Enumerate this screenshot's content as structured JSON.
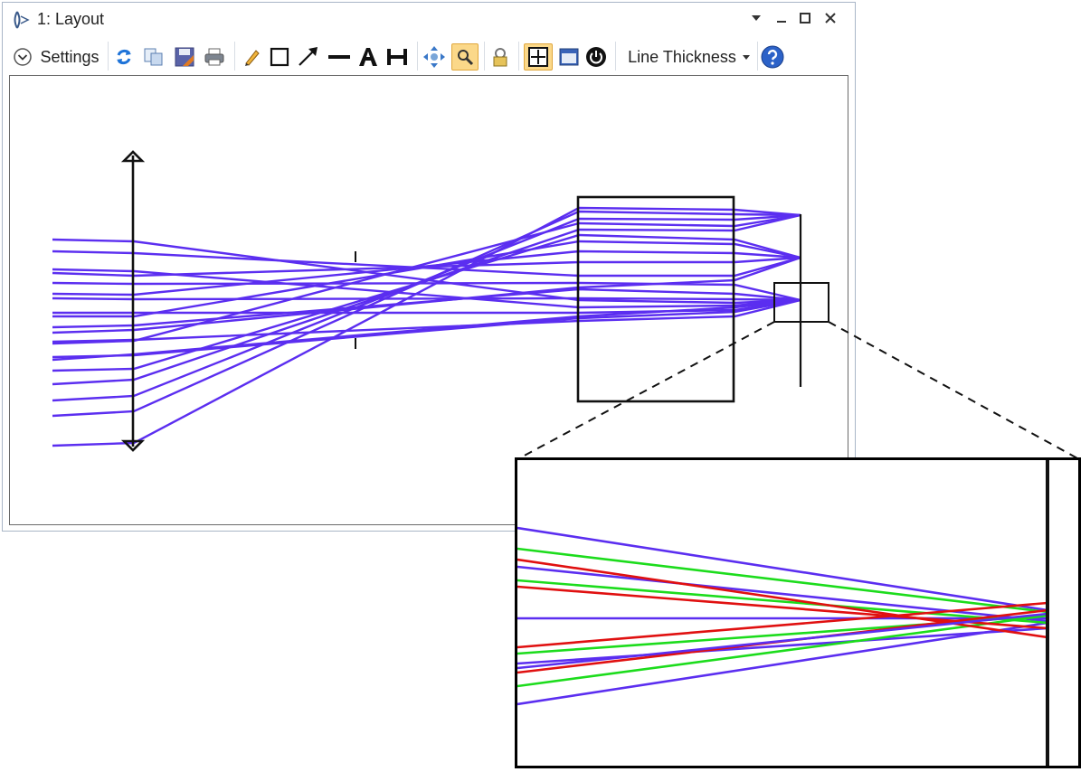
{
  "window": {
    "title": "1: Layout"
  },
  "toolbar": {
    "settings_label": "Settings",
    "line_thickness_label": "Line Thickness"
  },
  "icons": [
    "dropdown-arrow-icon",
    "minimize-icon",
    "maximize-icon",
    "close-icon",
    "settings-chevron-icon",
    "refresh-icon",
    "copy-icon",
    "save-icon",
    "print-icon",
    "pencil-icon",
    "rectangle-icon",
    "arrow-icon",
    "line-icon",
    "text-icon",
    "dimension-icon",
    "pan-icon",
    "zoom-icon",
    "lock-icon",
    "fit-view-icon",
    "window-icon",
    "power-icon",
    "help-icon"
  ],
  "colors": {
    "ray_blue": "#5b2ef0",
    "ray_green": "#1cdc1c",
    "ray_red": "#e01010",
    "toggled_bg": "#fbd889"
  }
}
